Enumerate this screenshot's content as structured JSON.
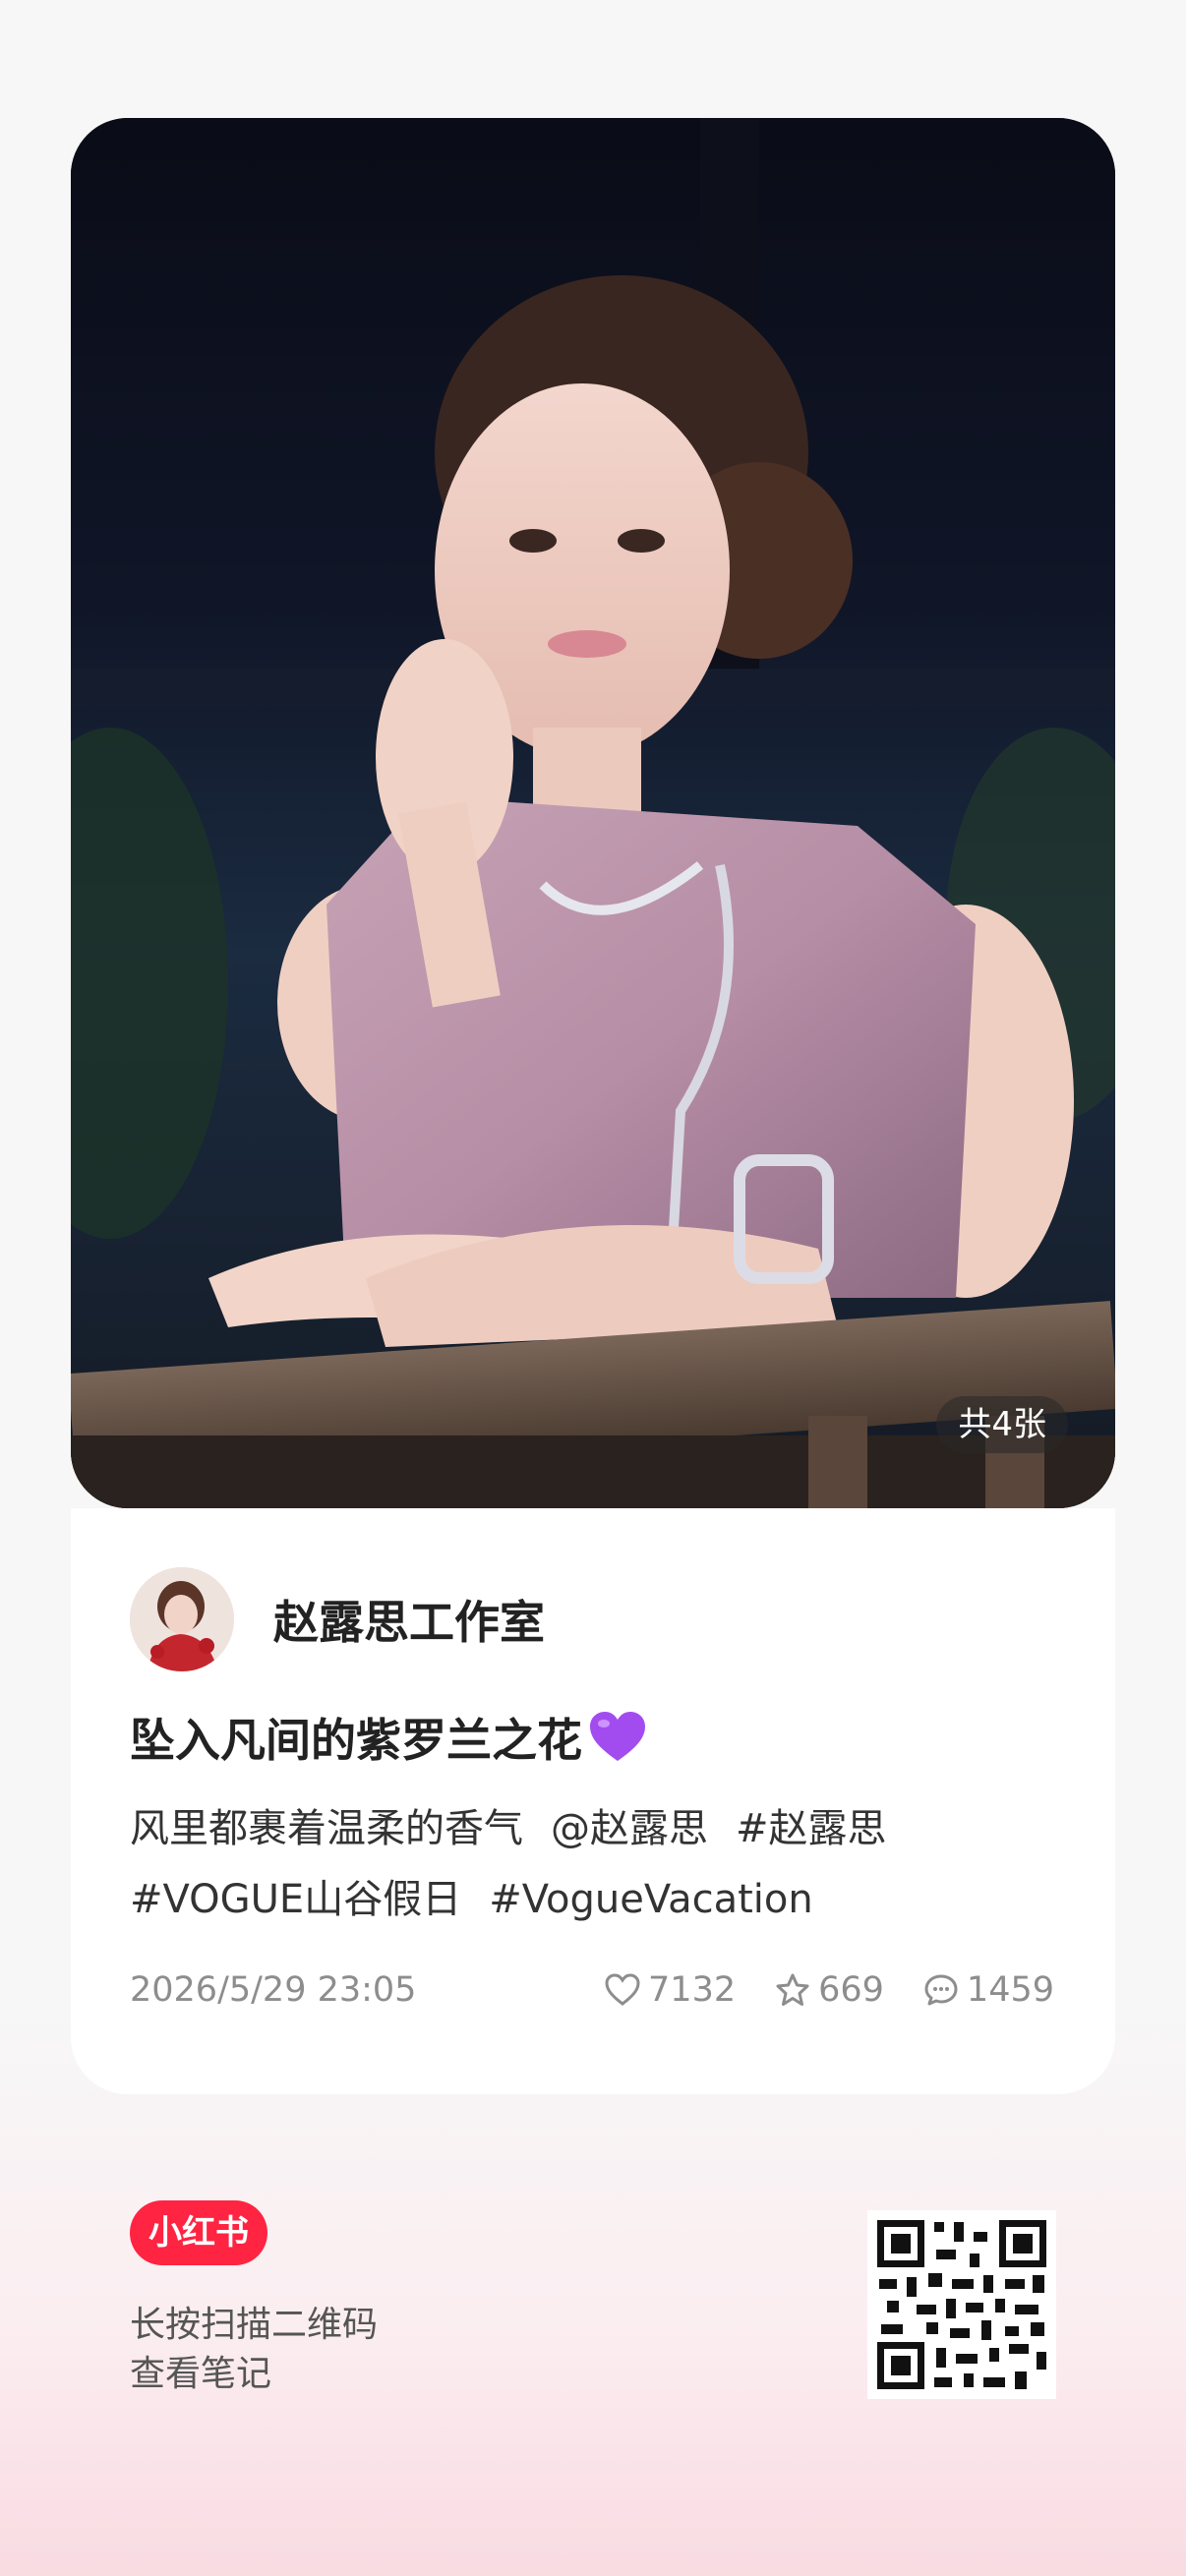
{
  "post": {
    "image_count": "共4张",
    "author": "赵露思工作室",
    "title": "坠入凡间的紫罗兰之花",
    "title_emoji": "purple-heart",
    "description": "风里都裹着温柔的香气",
    "mentions_tags": [
      "@赵露思",
      "#赵露思",
      "#VOGUE山谷假日",
      "#VogueVacation"
    ],
    "date": "2026/5/29 23:05",
    "likes": "7132",
    "collects": "669",
    "comments": "1459"
  },
  "footer": {
    "logo": "小红书",
    "line1": "长按扫描二维码",
    "line2": "查看笔记"
  },
  "colors": {
    "brand": "#ff2442",
    "purple_heart": "#a24cf0"
  }
}
